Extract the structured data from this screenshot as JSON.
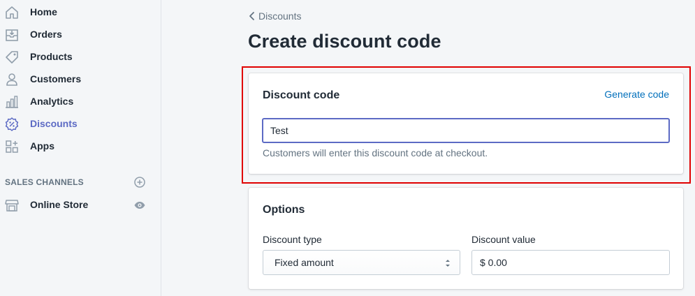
{
  "sidebar": {
    "items": [
      {
        "label": "Home",
        "icon": "home-icon",
        "active": false
      },
      {
        "label": "Orders",
        "icon": "orders-icon",
        "active": false
      },
      {
        "label": "Products",
        "icon": "tag-icon",
        "active": false
      },
      {
        "label": "Customers",
        "icon": "person-icon",
        "active": false
      },
      {
        "label": "Analytics",
        "icon": "bar-chart-icon",
        "active": false
      },
      {
        "label": "Discounts",
        "icon": "discount-icon",
        "active": true
      },
      {
        "label": "Apps",
        "icon": "apps-icon",
        "active": false
      }
    ],
    "sales_channels_heading": "SALES CHANNELS",
    "sales_channels_items": [
      {
        "label": "Online Store",
        "icon": "store-icon"
      }
    ]
  },
  "header": {
    "breadcrumb": "Discounts",
    "title": "Create discount code"
  },
  "discount_code_card": {
    "title": "Discount code",
    "generate_link": "Generate code",
    "code_value": "Test",
    "help_text": "Customers will enter this discount code at checkout."
  },
  "options_card": {
    "title": "Options",
    "discount_type_label": "Discount type",
    "discount_type_value": "Fixed amount",
    "discount_value_label": "Discount value",
    "discount_value_value": "$ 0.00"
  },
  "colors": {
    "accent": "#5c6ac4",
    "link": "#006fbb",
    "highlight": "#e00000"
  }
}
